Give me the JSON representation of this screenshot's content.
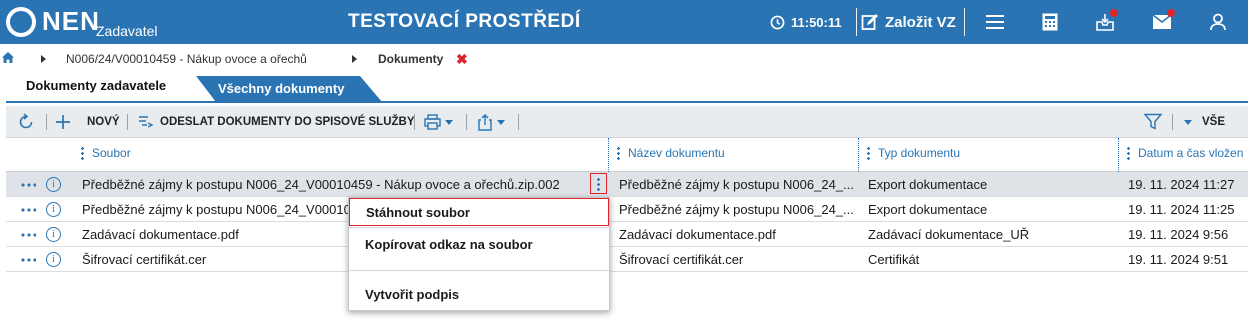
{
  "header": {
    "logo_text": "NEN",
    "logo_sub": "Zadavatel",
    "env_title": "TESTOVACÍ PROSTŘEDÍ",
    "clock": "11:50:11",
    "new_vz_label": "Založit VZ",
    "accent_color": "#2a74b3",
    "icons": [
      "clock-icon",
      "edit-icon",
      "menu-icon",
      "calculator-icon",
      "inbox-icon",
      "mail-icon",
      "user-icon"
    ]
  },
  "breadcrumb": {
    "items": [
      "N006/24/V00010459 - Nákup ovoce a ořechů",
      "Dokumenty"
    ],
    "close_symbol": "✖"
  },
  "tabs": [
    {
      "label": "Dokumenty zadavatele",
      "active": true
    },
    {
      "label": "Všechny dokumenty",
      "active": false
    }
  ],
  "toolbar": {
    "new_label": "NOVÝ",
    "send_label": "ODESLAT DOKUMENTY DO SPISOVÉ SLUŽBY",
    "filter_label": "VŠE"
  },
  "table": {
    "columns": [
      "Soubor",
      "Název dokumentu",
      "Typ dokumentu",
      "Datum a čas vložen"
    ],
    "rows": [
      {
        "file": "Předběžné zájmy k postupu N006_24_V00010459 - Nákup ovoce a ořechů.zip.002",
        "name": "Předběžné zájmy k postupu N006_24_...",
        "type": "Export dokumentace",
        "date": "19. 11. 2024 11:27"
      },
      {
        "file": "Předběžné zájmy k postupu N006_24_V00010",
        "name": "Předběžné zájmy k postupu N006_24_...",
        "type": "Export dokumentace",
        "date": "19. 11. 2024 11:25"
      },
      {
        "file": "Zadávací dokumentace.pdf",
        "name": "Zadávací dokumentace.pdf",
        "type": "Zadávací dokumentace_UŘ",
        "date": "19. 11. 2024 9:56"
      },
      {
        "file": "Šifrovací certifikát.cer",
        "name": "Šifrovací certifikát.cer",
        "type": "Certifikát",
        "date": "19. 11. 2024 9:51"
      }
    ],
    "info_symbol": "i"
  },
  "context_menu": {
    "items": [
      "Stáhnout soubor",
      "Kopírovat odkaz na soubor",
      "Vytvořit podpis"
    ]
  }
}
